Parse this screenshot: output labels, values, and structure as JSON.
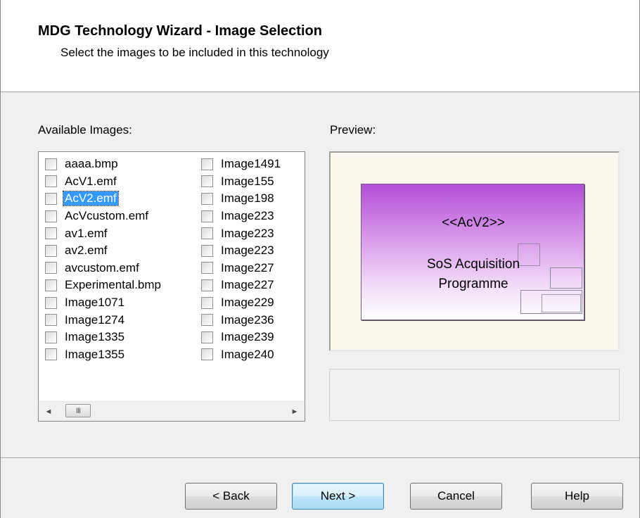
{
  "header": {
    "title": "MDG Technology Wizard - Image Selection",
    "subtitle": "Select the images to be included in this technology"
  },
  "available_images": {
    "label": "Available Images:",
    "column1": [
      {
        "name": "aaaa.bmp",
        "checked": false,
        "selected": false
      },
      {
        "name": "AcV1.emf",
        "checked": false,
        "selected": false
      },
      {
        "name": "AcV2.emf",
        "checked": false,
        "selected": true
      },
      {
        "name": "AcVcustom.emf",
        "checked": false,
        "selected": false
      },
      {
        "name": "av1.emf",
        "checked": false,
        "selected": false
      },
      {
        "name": "av2.emf",
        "checked": false,
        "selected": false
      },
      {
        "name": "avcustom.emf",
        "checked": false,
        "selected": false
      },
      {
        "name": "Experimental.bmp",
        "checked": false,
        "selected": false
      },
      {
        "name": "Image1071",
        "checked": false,
        "selected": false
      },
      {
        "name": "Image1274",
        "checked": false,
        "selected": false
      },
      {
        "name": "Image1335",
        "checked": false,
        "selected": false
      },
      {
        "name": "Image1355",
        "checked": false,
        "selected": false
      }
    ],
    "column2": [
      {
        "name": "Image1491",
        "checked": false
      },
      {
        "name": "Image155",
        "checked": false
      },
      {
        "name": "Image198",
        "checked": false
      },
      {
        "name": "Image223",
        "checked": false
      },
      {
        "name": "Image223",
        "checked": false
      },
      {
        "name": "Image223",
        "checked": false
      },
      {
        "name": "Image227",
        "checked": false
      },
      {
        "name": "Image227",
        "checked": false
      },
      {
        "name": "Image229",
        "checked": false
      },
      {
        "name": "Image236",
        "checked": false
      },
      {
        "name": "Image239",
        "checked": false
      },
      {
        "name": "Image240",
        "checked": false
      }
    ],
    "scrollbar": {
      "left_arrow": "◄",
      "right_arrow": "►",
      "thumb_grip": "III"
    }
  },
  "preview": {
    "label": "Preview:",
    "stereotype": "<<AcV2>>",
    "element_name": "SoS Acquisition Programme",
    "gradient_top_color": "#b24fd6",
    "gradient_bottom_color": "#ffffff",
    "background_color": "#fcf8ed"
  },
  "buttons": {
    "back": "< Back",
    "next": "Next >",
    "cancel": "Cancel",
    "help": "Help"
  },
  "colors": {
    "selection": "#3399ff",
    "dialog_background": "#f0f0f0"
  }
}
